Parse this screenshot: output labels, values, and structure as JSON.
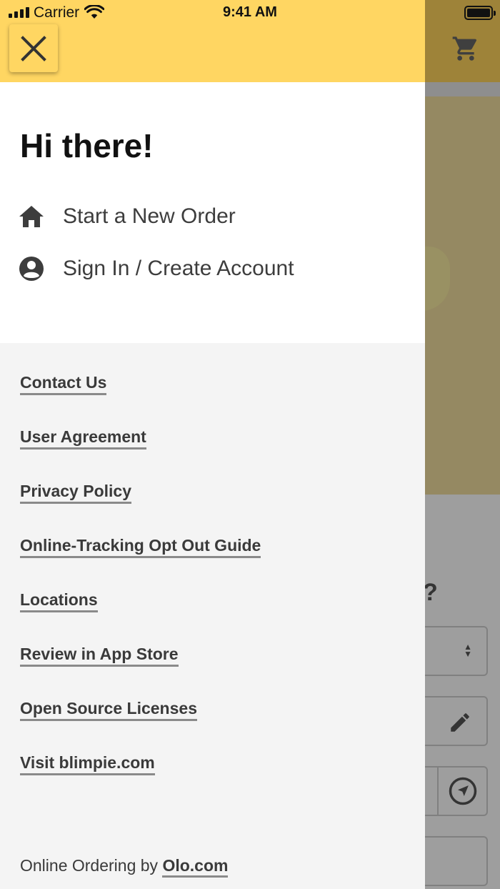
{
  "status_bar": {
    "carrier": "Carrier",
    "time": "9:41 AM"
  },
  "drawer": {
    "greeting": "Hi there!",
    "menu": [
      {
        "label": "Start a New Order",
        "icon": "home-icon"
      },
      {
        "label": "Sign In / Create Account",
        "icon": "account-circle-icon"
      }
    ],
    "links": [
      "Contact Us",
      "User Agreement",
      "Privacy Policy",
      "Online-Tracking Opt Out Guide",
      "Locations",
      "Review in App Store",
      "Open Source Licenses",
      "Visit blimpie.com"
    ],
    "footer": {
      "prefix": "Online Ordering by ",
      "link": "Olo.com"
    }
  },
  "background": {
    "question_mark": "?"
  },
  "colors": {
    "brand_yellow": "#ffd662",
    "drawer_bg": "#f4f4f4",
    "text_dark": "#3a3a3a"
  }
}
